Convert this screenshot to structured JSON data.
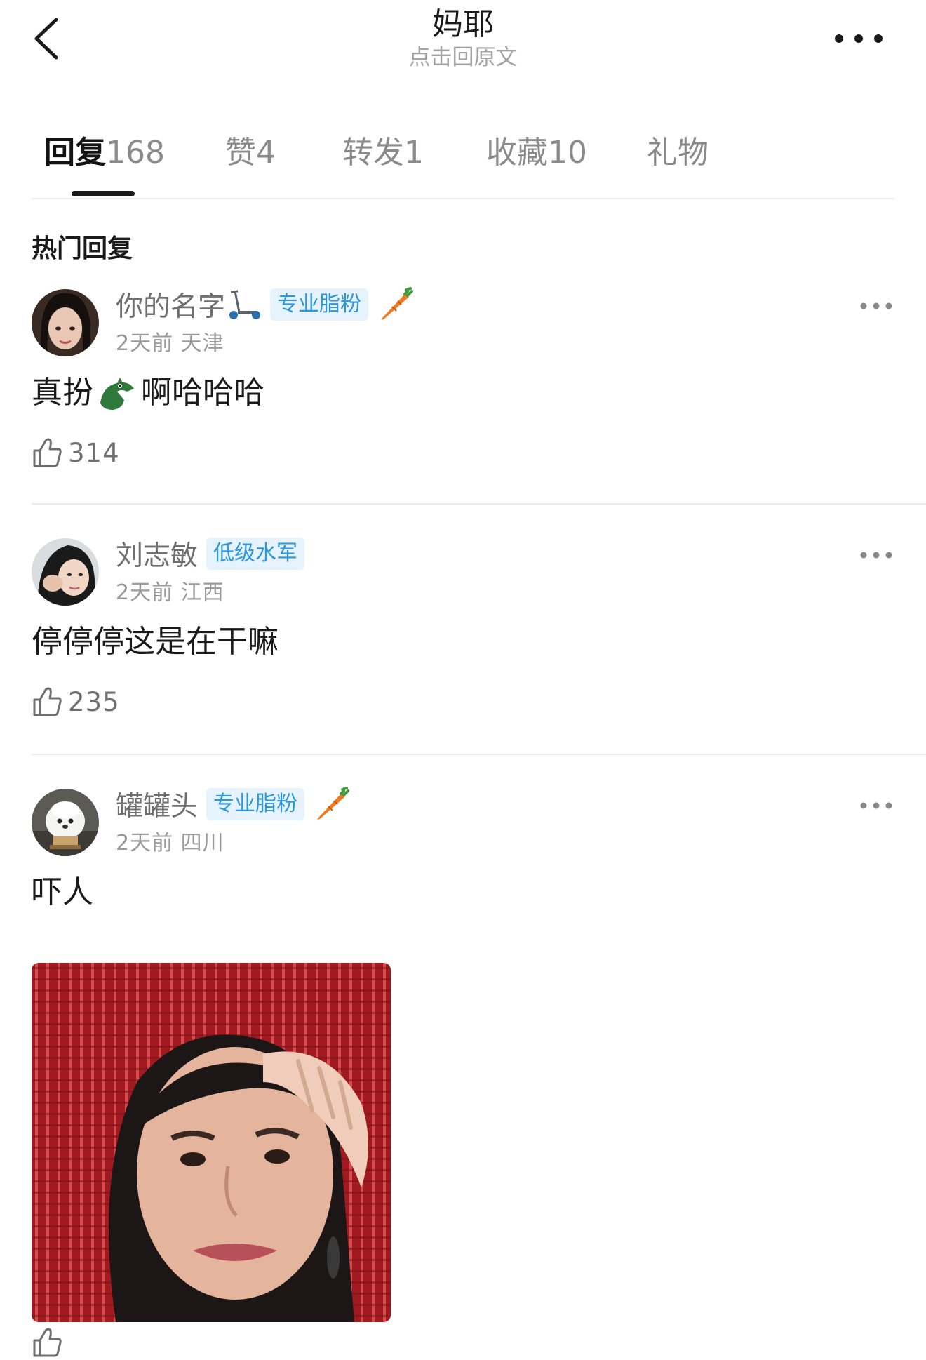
{
  "header": {
    "title": "妈耶",
    "subtitle": "点击回原文"
  },
  "tabs": [
    {
      "label": "回复",
      "count": "168"
    },
    {
      "label": "赞",
      "count": "4"
    },
    {
      "label": "转发",
      "count": "1"
    },
    {
      "label": "收藏",
      "count": "10"
    },
    {
      "label": "礼物",
      "count": ""
    }
  ],
  "section_title": "热门回复",
  "comments": [
    {
      "username": "你的名字",
      "badge": "专业脂粉",
      "meta": "2天前 天津",
      "text_before": "真扮",
      "text_after": "啊哈哈哈",
      "likes": "314",
      "icons": [
        "scooter-icon",
        "carrot-icon",
        "crocodile-emoji"
      ]
    },
    {
      "username": "刘志敏",
      "badge": "低级水军",
      "meta": "2天前 江西",
      "text": "停停停这是在干嘛",
      "likes": "235"
    },
    {
      "username": "罐罐头",
      "badge": "专业脂粉",
      "meta": "2天前 四川",
      "text": "吓人",
      "likes": "",
      "icons": [
        "carrot-icon"
      ]
    }
  ],
  "colors": {
    "badge_text": "#2c97de",
    "badge_bg": "#e6f3fc",
    "muted": "#9a9a9a",
    "primary_text": "#1a1a1a"
  }
}
